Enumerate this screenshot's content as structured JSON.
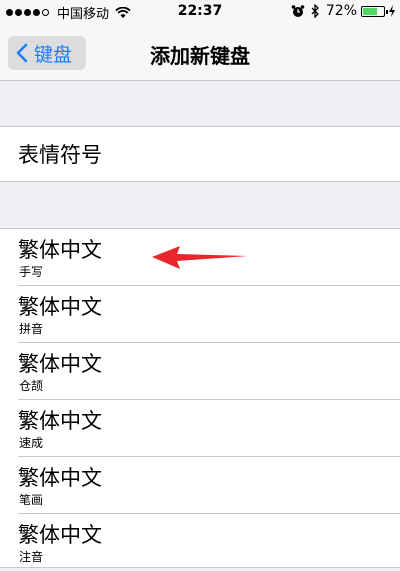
{
  "status": {
    "carrier": "中国移动",
    "time": "22:37",
    "battery": "72%",
    "battery_level": 0.72,
    "battery_color": "#4cd964"
  },
  "nav": {
    "back_label": "键盘",
    "title": "添加新键盘"
  },
  "group1": {
    "items": [
      {
        "label": "表情符号"
      }
    ]
  },
  "group2": {
    "items": [
      {
        "title": "繁体中文",
        "subtitle": "手写"
      },
      {
        "title": "繁体中文",
        "subtitle": "拼音"
      },
      {
        "title": "繁体中文",
        "subtitle": "仓颉"
      },
      {
        "title": "繁体中文",
        "subtitle": "速成"
      },
      {
        "title": "繁体中文",
        "subtitle": "笔画"
      },
      {
        "title": "繁体中文",
        "subtitle": "注音"
      }
    ]
  },
  "annotation_color": "#e8262b",
  "accent_color": "#1a7ef5"
}
